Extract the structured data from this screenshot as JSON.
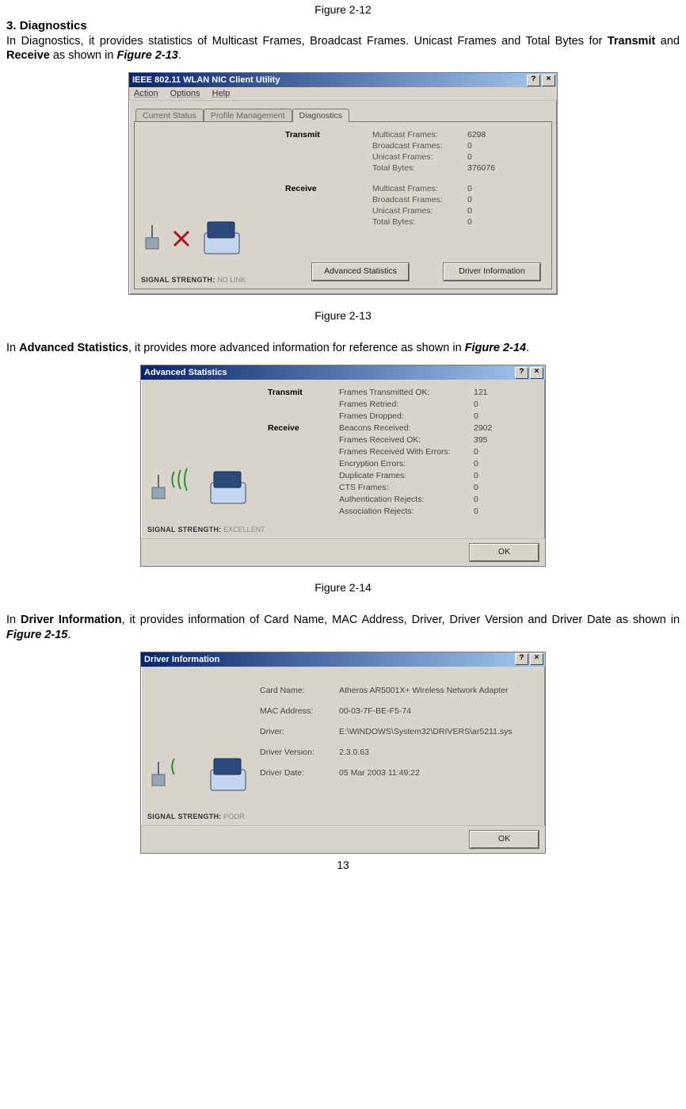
{
  "top_figure_label": "Figure 2-12",
  "section_number": "3.",
  "section_title": "Diagnostics",
  "para1_pre": "In Diagnostics, it provides statistics of Multicast Frames, Broadcast Frames. Unicast Frames and Total Bytes for ",
  "para1_b1": "Transmit",
  "para1_mid": " and ",
  "para1_b2": "Receive",
  "para1_mid2": " as shown in ",
  "para1_ref": "Figure 2-13",
  "dot": ".",
  "fig13": {
    "title": "IEEE 802.11 WLAN NIC Client Utility",
    "help_q": "?",
    "close_x": "×",
    "menu": {
      "action": "Action",
      "options": "Options",
      "help": "Help"
    },
    "tabs": {
      "current": "Current Status",
      "profile": "Profile Management",
      "diag": "Diagnostics"
    },
    "transmit_head": "Transmit",
    "receive_head": "Receive",
    "labels": {
      "mcf": "Multicast Frames:",
      "bcf": "Broadcast Frames:",
      "ucf": "Unicast Frames:",
      "tb": "Total Bytes:"
    },
    "tx": {
      "mcf": "6298",
      "bcf": "0",
      "ucf": "0",
      "tb": "376076"
    },
    "rx": {
      "mcf": "0",
      "bcf": "0",
      "ucf": "0",
      "tb": "0"
    },
    "signal_label": "SIGNAL STRENGTH:",
    "signal_value": "NO LINK",
    "btn_adv": "Advanced Statistics",
    "btn_drv": "Driver Information"
  },
  "fig13_caption": "Figure 2-13",
  "para2_pre": "In ",
  "para2_b": "Advanced Statistics",
  "para2_rest": ", it provides more advanced information for reference as shown in ",
  "para2_ref": "Figure 2-14",
  "fig14": {
    "title": "Advanced Statistics",
    "help_q": "?",
    "close_x": "×",
    "transmit_head": "Transmit",
    "receive_head": "Receive",
    "rows": {
      "fto": "Frames Transmitted OK:",
      "fr": "Frames Retried:",
      "fd": "Frames Dropped:",
      "br": "Beacons Received:",
      "fro": "Frames Received OK:",
      "fre": "Frames Received With Errors:",
      "ee": "Encryption Errors:",
      "df": "Duplicate Frames:",
      "cts": "CTS Frames:",
      "ar": "Authentication Rejects:",
      "asr": "Association Rejects:"
    },
    "vals": {
      "fto": "121",
      "fr": "0",
      "fd": "0",
      "br": "2902",
      "fro": "395",
      "fre": "0",
      "ee": "0",
      "df": "0",
      "cts": "0",
      "ar": "0",
      "asr": "0"
    },
    "signal_label": "SIGNAL STRENGTH:",
    "signal_value": "EXCELLENT",
    "btn_ok": "OK"
  },
  "fig14_caption": "Figure 2-14",
  "para3_pre": "In ",
  "para3_b": "Driver Information",
  "para3_rest": ", it provides information of Card Name, MAC Address, Driver, Driver Version and Driver Date as shown in ",
  "para3_ref": "Figure 2-15",
  "fig15": {
    "title": "Driver Information",
    "help_q": "?",
    "close_x": "×",
    "rows": {
      "card": "Card Name:",
      "mac": "MAC Address:",
      "drv": "Driver:",
      "ver": "Driver Version:",
      "date": "Driver Date:"
    },
    "vals": {
      "card": "Atheros AR5001X+ Wireless Network Adapter",
      "mac": "00-03-7F-BE-F5-74",
      "drv": "E:\\WINDOWS\\System32\\DRIVERS\\ar5211.sys",
      "ver": "2.3.0.63",
      "date": "05 Mar 2003 11:49:22"
    },
    "signal_label": "SIGNAL STRENGTH:",
    "signal_value": "POOR",
    "btn_ok": "OK"
  },
  "page_number": "13"
}
